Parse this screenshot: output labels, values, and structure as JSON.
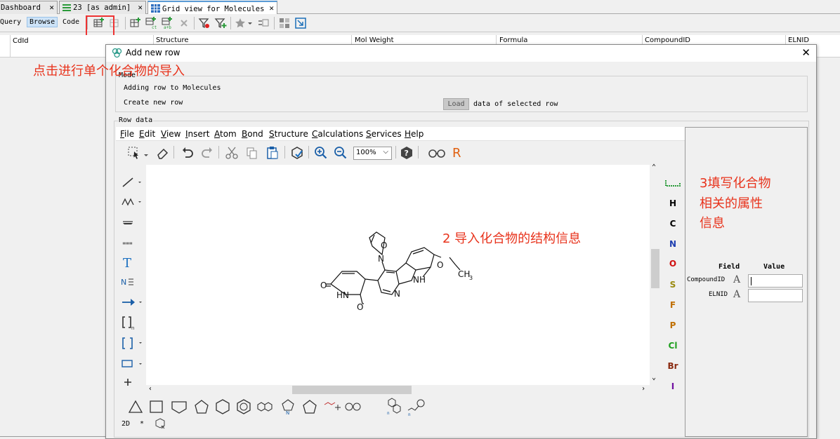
{
  "tabs": [
    {
      "label": "Dashboard",
      "active": false
    },
    {
      "label": "23 [as admin]",
      "active": false
    },
    {
      "label": "Grid view for Molecules",
      "active": true
    }
  ],
  "toolbar": {
    "query": "Query",
    "browse": "Browse",
    "code": "Code"
  },
  "grid": {
    "columns": [
      "CdId",
      "Structure",
      "Mol Weight",
      "Formula",
      "CompoundID",
      "ELNID"
    ]
  },
  "dialog": {
    "title": "Add new row",
    "mode_label": "Mode",
    "adding_text": "Adding row to Molecules",
    "create_text": "Create new row",
    "load_button": "Load",
    "load_suffix": "data of selected row",
    "row_data_label": "Row data"
  },
  "editor": {
    "menus": [
      "File",
      "Edit",
      "View",
      "Insert",
      "Atom",
      "Bond",
      "Structure",
      "Calculations",
      "Services",
      "Help"
    ],
    "zoom": "100%",
    "elements": [
      {
        "sym": "H",
        "color": "#000000"
      },
      {
        "sym": "C",
        "color": "#000000"
      },
      {
        "sym": "N",
        "color": "#1f3fb0"
      },
      {
        "sym": "O",
        "color": "#d01010"
      },
      {
        "sym": "S",
        "color": "#9a8a10"
      },
      {
        "sym": "F",
        "color": "#c07000"
      },
      {
        "sym": "P",
        "color": "#c07000"
      },
      {
        "sym": "Cl",
        "color": "#20a020"
      },
      {
        "sym": "Br",
        "color": "#8a2a10"
      },
      {
        "sym": "I",
        "color": "#7010a0"
      }
    ],
    "bottom_left": "2D",
    "bottom_star": "*",
    "molecule_labels": {
      "o_left": "O",
      "nh_ring": "HN",
      "o_bottom": "O",
      "n_pyr": "N",
      "nh_indole": "NH",
      "o_ethoxy": "O",
      "ch3": "CH",
      "ch3_sub": "3",
      "iso_o": "O",
      "iso_n": "N"
    }
  },
  "fields": {
    "field_header": "Field",
    "value_header": "Value",
    "rows": [
      {
        "name": "CompoundID",
        "type": "A"
      },
      {
        "name": "ELNID",
        "type": "A"
      }
    ]
  },
  "annotations": {
    "step1": "点击进行单个化合物的导入",
    "step2": "2 导入化合物的结构信息",
    "step3_line1": "3填写化合物",
    "step3_line2": "相关的属性",
    "step3_line3": "信息"
  }
}
